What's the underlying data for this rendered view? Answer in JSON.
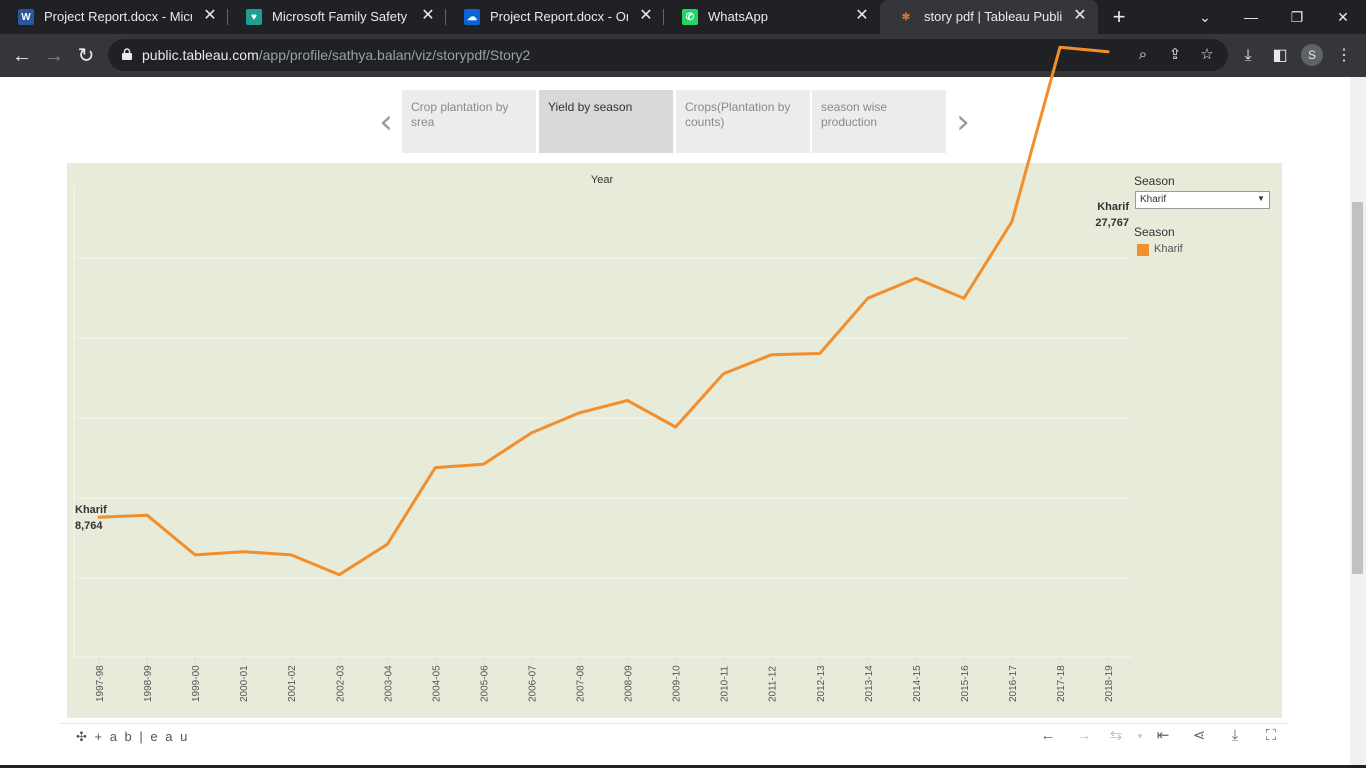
{
  "browser": {
    "tabs": [
      {
        "title": "Project Report.docx - Micros",
        "favicon": "word-icon",
        "color": "#2b579a",
        "glyph": "W"
      },
      {
        "title": "Microsoft Family Safety",
        "favicon": "family-safety-icon",
        "color": "#1e9f8f",
        "glyph": "♥"
      },
      {
        "title": "Project Report.docx - OneDr",
        "favicon": "onedrive-icon",
        "color": "#0a64d6",
        "glyph": "☁"
      },
      {
        "title": "WhatsApp",
        "favicon": "whatsapp-icon",
        "color": "#25d366",
        "glyph": "✆"
      },
      {
        "title": "story pdf | Tableau Public",
        "favicon": "tableau-icon",
        "color": "#e8762d",
        "glyph": "✻"
      }
    ],
    "url_host": "public.tableau.com",
    "url_path": "/app/profile/sathya.balan/viz/storypdf/Story2",
    "profile_initial": "S"
  },
  "story": {
    "points": [
      {
        "label": "Crop plantation by srea",
        "active": false
      },
      {
        "label": "Yield by season",
        "active": true
      },
      {
        "label": "Crops(Plantation by counts)",
        "active": false
      },
      {
        "label": "season wise production",
        "active": false
      }
    ]
  },
  "filter": {
    "title": "Season",
    "selected": "Kharif"
  },
  "legend": {
    "title": "Season",
    "items": [
      {
        "label": "Kharif",
        "color": "#f28e2b"
      }
    ]
  },
  "footer": {
    "logo": "+ a b | e a u"
  },
  "chart_data": {
    "type": "line",
    "title": "Year",
    "xlabel": "",
    "ylabel": "",
    "categories": [
      "1997-98",
      "1998-99",
      "1999-00",
      "2000-01",
      "2001-02",
      "2002-03",
      "2003-04",
      "2004-05",
      "2005-06",
      "2006-07",
      "2007-08",
      "2008-09",
      "2009-10",
      "2010-11",
      "2011-12",
      "2012-13",
      "2013-14",
      "2014-15",
      "2015-16",
      "2016-17",
      "2017-18",
      "2018-19"
    ],
    "series": [
      {
        "name": "Kharif",
        "color": "#f28e2b",
        "values": [
          8764,
          8850,
          7230,
          7360,
          7230,
          6420,
          7660,
          10790,
          10930,
          12210,
          13030,
          13530,
          12450,
          14630,
          15400,
          15450,
          17700,
          18520,
          17700,
          20830,
          27950,
          27767
        ]
      }
    ],
    "annotations": [
      {
        "category": "1997-98",
        "label": "Kharif",
        "value_label": "8,764"
      },
      {
        "category": "2018-19",
        "label": "Kharif",
        "value_label": "27,767"
      }
    ],
    "grid": true,
    "y_axis_labels_shown": false,
    "legend_position": "right"
  }
}
